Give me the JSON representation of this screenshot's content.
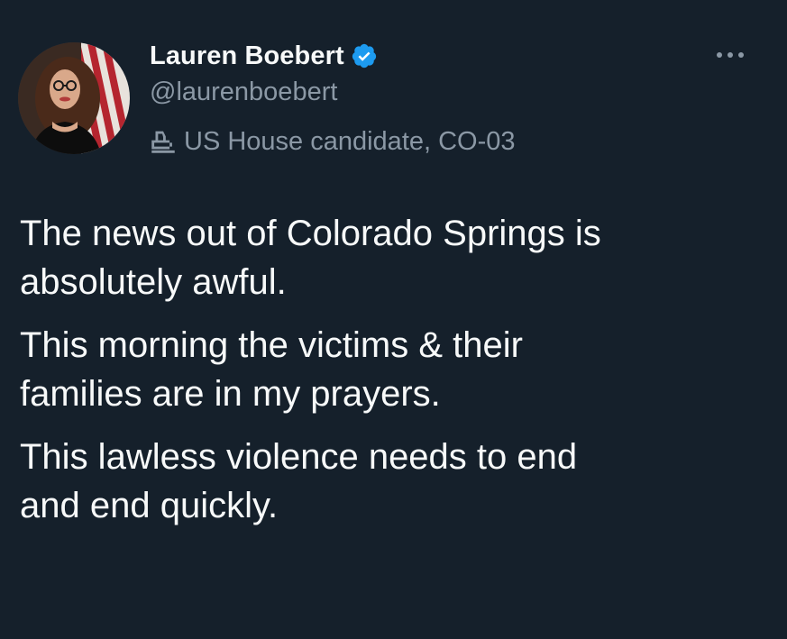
{
  "author": {
    "display_name": "Lauren Boebert",
    "handle": "@laurenboebert",
    "affiliation": "US House candidate, CO-03",
    "verified_icon": "verified-badge-icon",
    "affiliation_icon": "government-building-icon",
    "avatar": "profile-photo-avatar"
  },
  "menu": {
    "icon": "more-options-icon"
  },
  "tweet": {
    "paragraphs": [
      "The news out of Colorado Springs is\nabsolutely awful.",
      "This morning the victims & their\nfamilies are in my prayers.",
      "This lawless violence needs to end\nand end quickly."
    ]
  },
  "colors": {
    "background": "#15202b",
    "text_primary": "#f7f9f9",
    "text_secondary": "#8b98a5",
    "verified_blue": "#1d9bf0"
  }
}
